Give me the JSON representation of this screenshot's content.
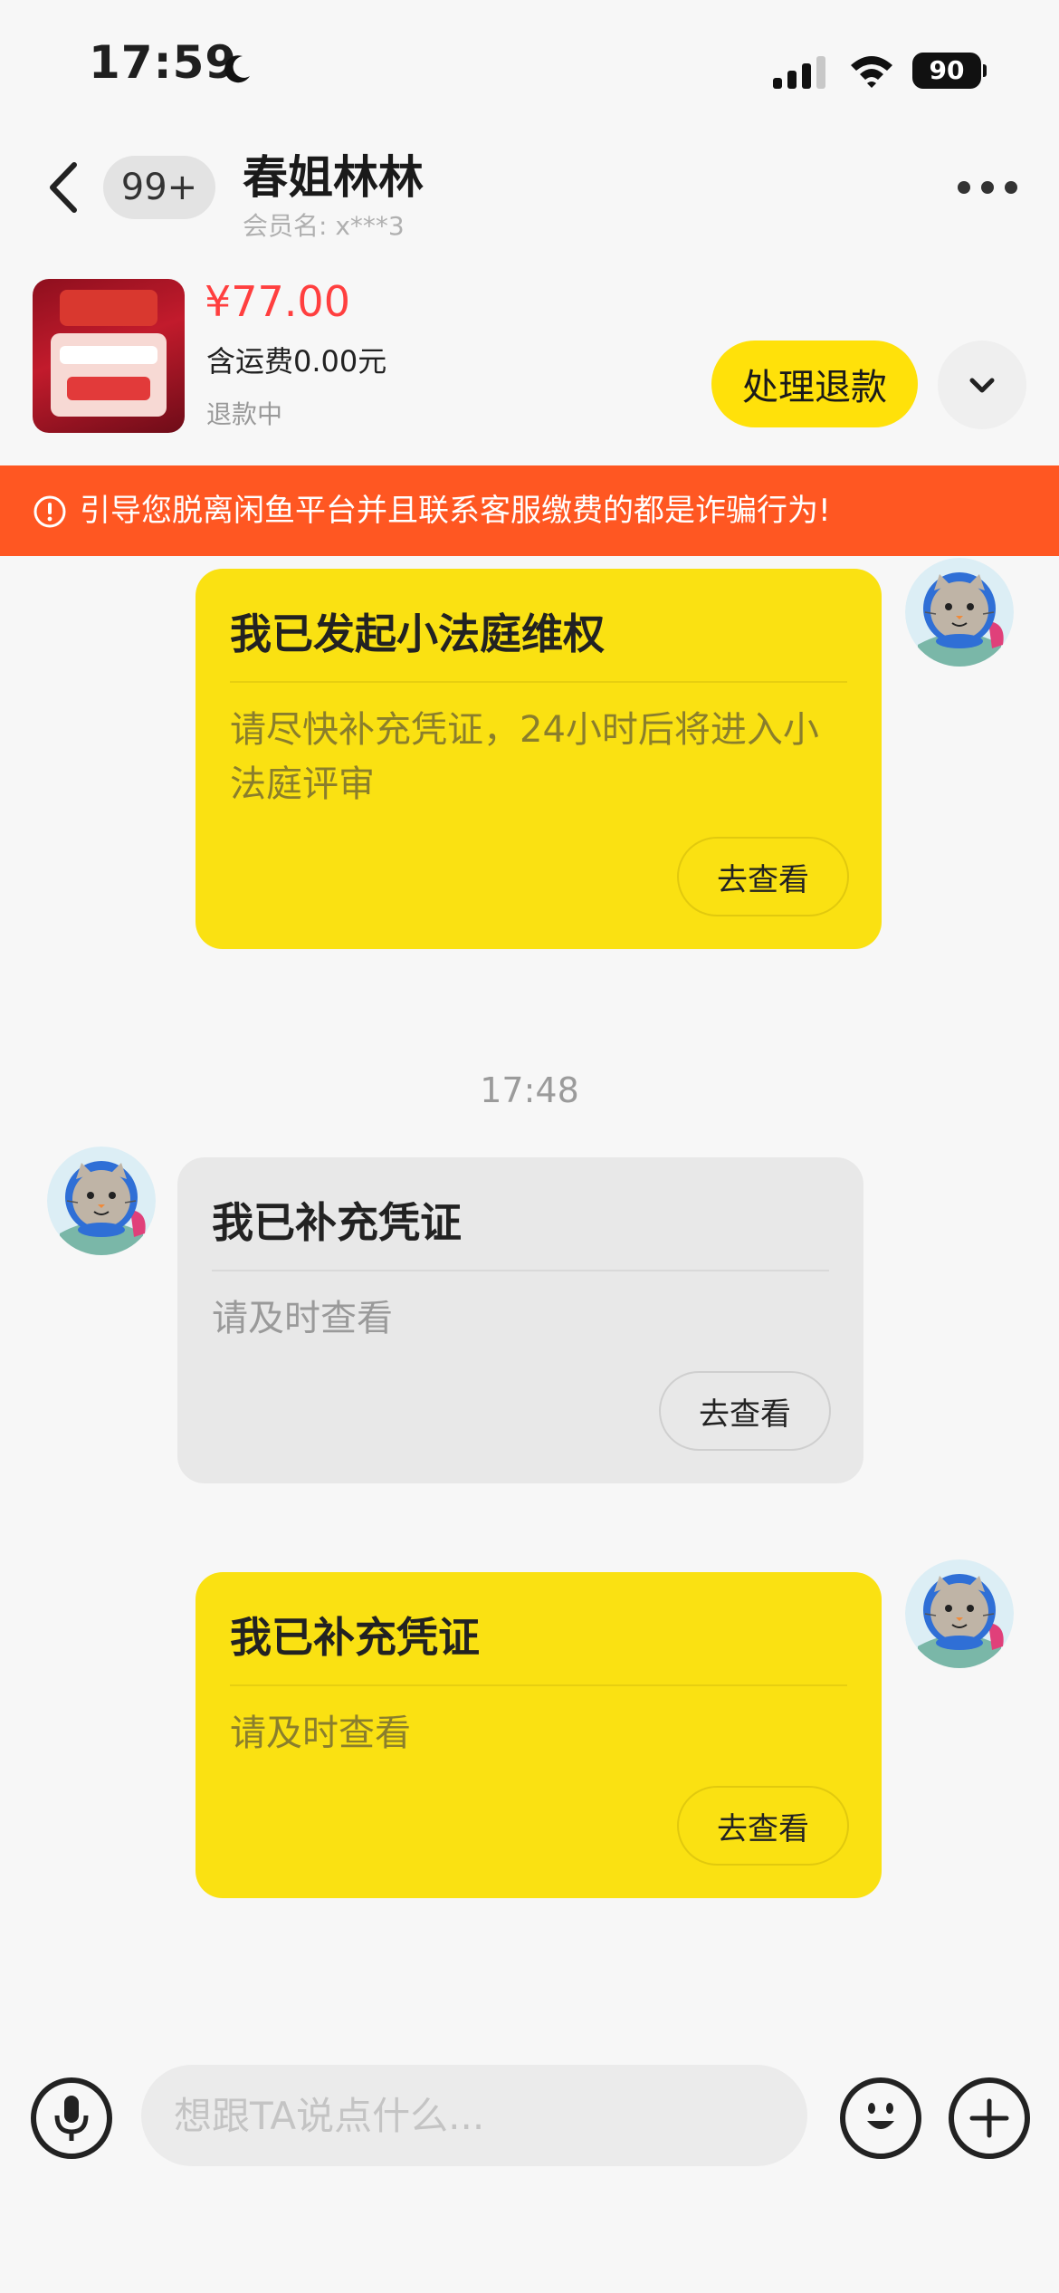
{
  "status_bar": {
    "time": "17:59",
    "battery": "90",
    "icons": [
      "moon-icon",
      "signal-icon",
      "wifi-icon",
      "battery-icon"
    ]
  },
  "header": {
    "unread_badge": "99+",
    "chat_name": "春姐林林",
    "member_name": "会员名:  x***3",
    "icons": [
      "back-arrow-icon",
      "more-dots-icon"
    ]
  },
  "product": {
    "price": "¥77.00",
    "shipping": "含运费0.00元",
    "status": "退款中",
    "refund_button": "处理退款",
    "expand_icon": "chevron-down-icon"
  },
  "warning": {
    "text": "引导您脱离闲鱼平台并且联系客服缴费的都是诈骗行为!",
    "icon": "warning-icon"
  },
  "messages": [
    {
      "side": "right",
      "style": "yellow",
      "title": "我已发起小法庭维权",
      "body": "请尽快补充凭证，24小时后将进入小法庭评审",
      "button": "去查看"
    },
    {
      "timestamp": "17:48"
    },
    {
      "side": "left",
      "style": "gray",
      "title": "我已补充凭证",
      "body": "请及时查看",
      "button": "去查看"
    },
    {
      "side": "right",
      "style": "yellow",
      "title": "我已补充凭证",
      "body": "请及时查看",
      "button": "去查看"
    }
  ],
  "input_bar": {
    "placeholder": "想跟TA说点什么...",
    "icons": [
      "microphone-icon",
      "emoji-icon",
      "plus-icon"
    ]
  },
  "colors": {
    "accent_yellow": "#fae112",
    "button_yellow": "#ffe10a",
    "price_red": "#ff3f3f",
    "warning_orange": "#ff5722",
    "background": "#f7f7f7"
  }
}
